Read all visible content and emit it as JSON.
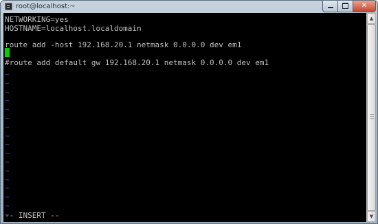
{
  "window": {
    "title": "root@localhost:~",
    "min_glyph": "",
    "max_glyph": "",
    "close_glyph": "✕"
  },
  "editor": {
    "lines": [
      "NETWORKING=yes",
      "HOSTNAME=localhost.localdomain",
      "",
      "route add -host 192.168.20.1 netmask 0.0.0.0 dev em1",
      "",
      "#route add default gw 192.168.20.1 netmask 0.0.0.0 dev em1"
    ],
    "tilde": "~",
    "tilde_count": 17,
    "status": "-- INSERT --"
  },
  "colors": {
    "terminal_bg": "#000000",
    "text": "#c0c0c0",
    "tilde": "#5050d0",
    "cursor": "#00d000"
  },
  "scrollbar": {
    "up_arrow": "▲",
    "down_arrow": "▼"
  }
}
